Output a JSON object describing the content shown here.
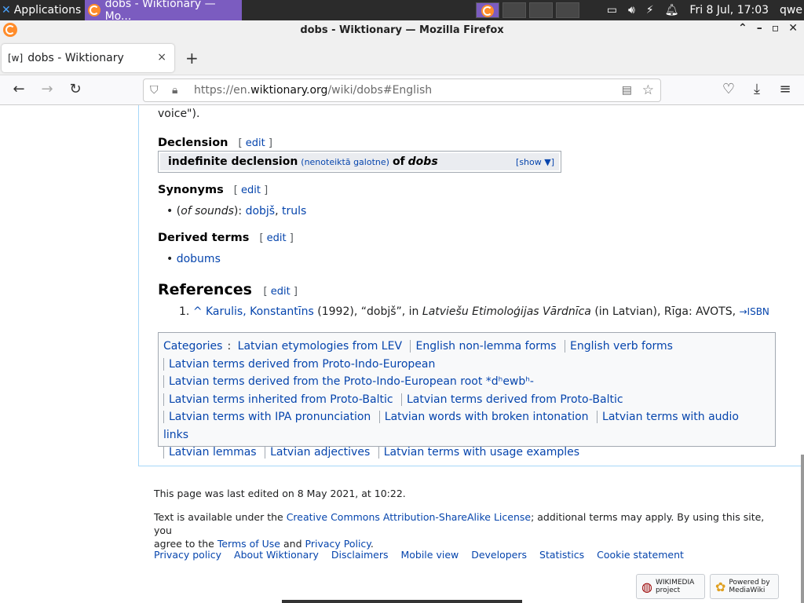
{
  "taskbar": {
    "applications_label": "Applications",
    "active_window": "dobs - Wiktionary — Mo...",
    "clock": "Fri  8 Jul, 17:03",
    "user": "qwe"
  },
  "window": {
    "title": "dobs - Wiktionary — Mozilla Firefox"
  },
  "tab": {
    "icon_text": "[w]",
    "label": "dobs - Wiktionary",
    "close": "×",
    "new_tab": "+"
  },
  "url": {
    "prefix": "https://en.",
    "domain": "wiktionary.org",
    "path": "/wiki/dobs#English"
  },
  "article": {
    "voice_tail": "voice\").",
    "declension_heading": "Declension",
    "edit": "edit",
    "declension_box": {
      "title": "indefinite declension",
      "sub": "(nenoteiktā galotne)",
      "of": "of",
      "word": "dobs",
      "show": "[show ▼]"
    },
    "synonyms_heading": "Synonyms",
    "synonyms": {
      "paren_open": "(",
      "context": "of sounds",
      "paren_close": "):",
      "item1": "dobjš",
      "comma": ",",
      "item2": "truls"
    },
    "derived_heading": "Derived terms",
    "derived_item": "dobums",
    "references_heading": "References",
    "reference": {
      "num": "1.",
      "caret": "^",
      "author": "Karulis, Konstantīns",
      "year_part": "(1992), “dobjš”, in",
      "work": "Latviešu Etimoloģijas Vārdnīca",
      "tail": "(in Latvian), Rīga: AVOTS,",
      "isbn": "→ISBN"
    }
  },
  "categories": {
    "label": "Categories",
    "rows": [
      [
        "Latvian etymologies from LEV",
        "English non-lemma forms",
        "English verb forms"
      ],
      [
        "Latvian terms derived from Proto-Indo-European"
      ],
      [
        "Latvian terms derived from the Proto-Indo-European root *dʰewbʰ-"
      ],
      [
        "Latvian terms inherited from Proto-Baltic",
        "Latvian terms derived from Proto-Baltic"
      ],
      [
        "Latvian terms with IPA pronunciation",
        "Latvian words with broken intonation",
        "Latvian terms with audio links"
      ],
      [
        "Latvian lemmas",
        "Latvian adjectives",
        "Latvian terms with usage examples"
      ]
    ]
  },
  "footer": {
    "last_edited": "This page was last edited on 8 May 2021, at 10:22.",
    "license_pre": "Text is available under the",
    "license_link": "Creative Commons Attribution-ShareAlike License",
    "license_post": "; additional terms may apply. By using this site, you",
    "agree_pre": "agree to the",
    "terms": "Terms of Use",
    "and": "and",
    "privacy": "Privacy Policy",
    "links": [
      "Privacy policy",
      "About Wiktionary",
      "Disclaimers",
      "Mobile view",
      "Developers",
      "Statistics",
      "Cookie statement"
    ],
    "wikimedia_badge": "WIKIMEDIA project",
    "mediawiki_badge": "Powered by MediaWiki"
  }
}
